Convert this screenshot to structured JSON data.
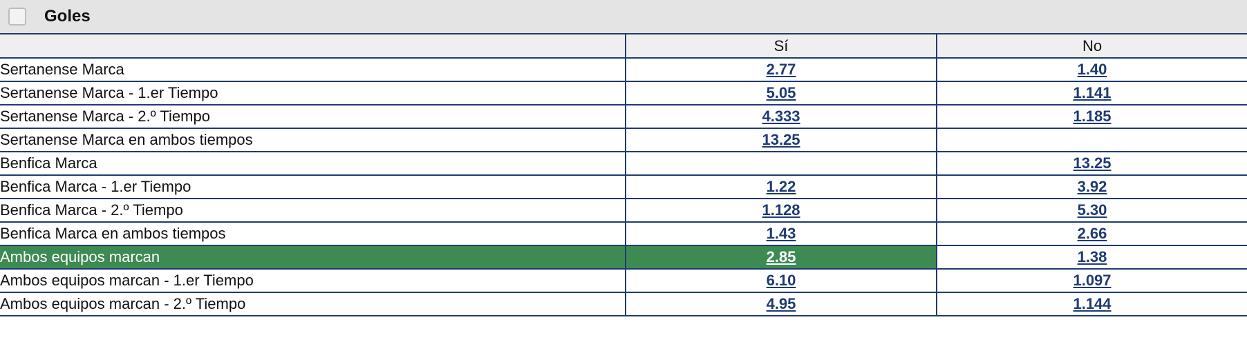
{
  "section": {
    "title": "Goles"
  },
  "columns": {
    "yes": "Sí",
    "no": "No"
  },
  "colors": {
    "border": "#1f3a73",
    "link": "#1f3a73",
    "highlight": "#3d8a52",
    "header_bg": "#e4e4e4"
  },
  "rows": [
    {
      "name": "Sertanense Marca",
      "yes": "2.77",
      "no": "1.40"
    },
    {
      "name": "Sertanense Marca - 1.er Tiempo",
      "yes": "5.05",
      "no": "1.141"
    },
    {
      "name": "Sertanense Marca - 2.º Tiempo",
      "yes": "4.333",
      "no": "1.185"
    },
    {
      "name": "Sertanense Marca en ambos tiempos",
      "yes": "13.25",
      "no": ""
    },
    {
      "name": "Benfica Marca",
      "yes": "",
      "no": "13.25"
    },
    {
      "name": "Benfica Marca - 1.er Tiempo",
      "yes": "1.22",
      "no": "3.92"
    },
    {
      "name": "Benfica Marca - 2.º Tiempo",
      "yes": "1.128",
      "no": "5.30"
    },
    {
      "name": "Benfica Marca en ambos tiempos",
      "yes": "1.43",
      "no": "2.66"
    },
    {
      "name": "Ambos equipos marcan",
      "yes": "2.85",
      "no": "1.38",
      "selected": true
    },
    {
      "name": "Ambos equipos marcan - 1.er Tiempo",
      "yes": "6.10",
      "no": "1.097"
    },
    {
      "name": "Ambos equipos marcan - 2.º Tiempo",
      "yes": "4.95",
      "no": "1.144"
    }
  ]
}
